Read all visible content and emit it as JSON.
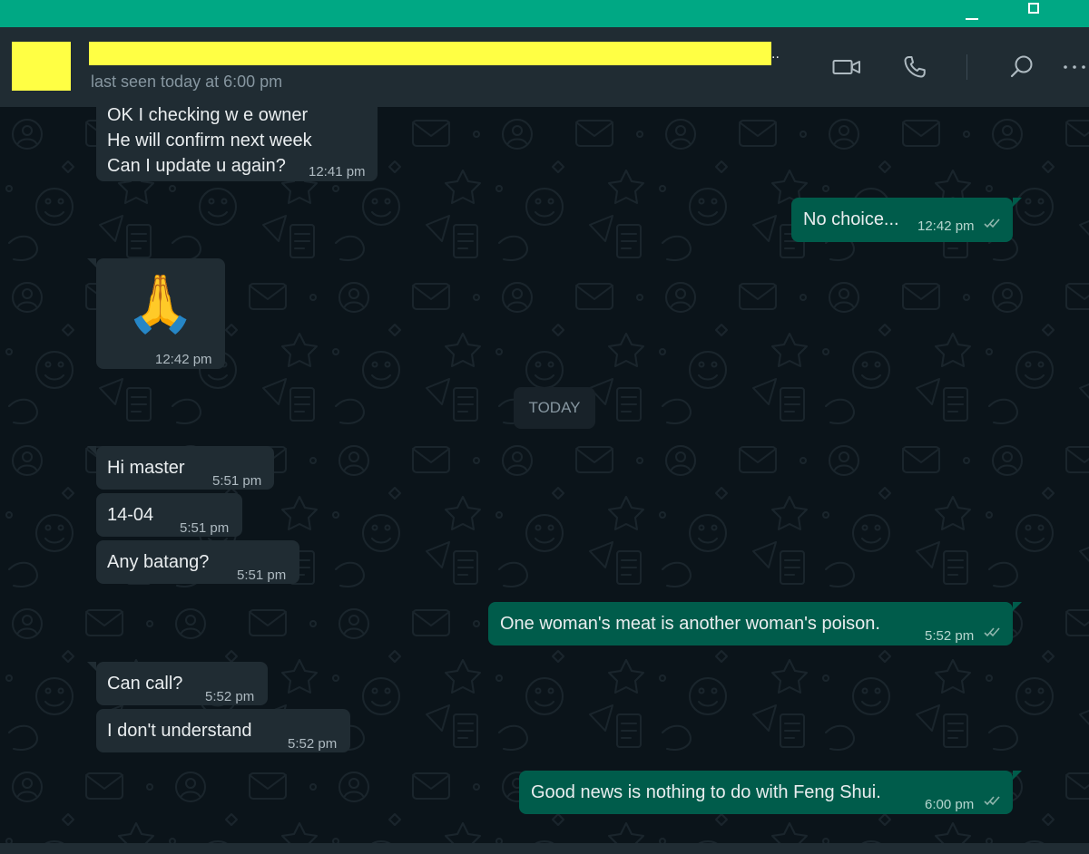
{
  "header": {
    "name_suffix": "..",
    "last_seen": "last seen today at 6:00 pm"
  },
  "icons": {
    "video": "video-call-icon",
    "call": "voice-call-icon",
    "search": "search-icon",
    "more": "more-options-icon"
  },
  "day_divider": "TODAY",
  "messages": [
    {
      "dir": "in",
      "lines": [
        "OK I checking w e owner",
        "He will confirm next week",
        "Can I update u again?"
      ],
      "time": "12:41 pm"
    },
    {
      "dir": "out",
      "text": "No choice...",
      "time": "12:42 pm"
    },
    {
      "dir": "in",
      "emoji": "🙏",
      "time": "12:42 pm"
    },
    {
      "dir": "in",
      "text": "Hi master",
      "time": "5:51 pm"
    },
    {
      "dir": "in",
      "text": "14-04",
      "time": "5:51 pm"
    },
    {
      "dir": "in",
      "text": "Any batang?",
      "time": "5:51 pm"
    },
    {
      "dir": "out",
      "text": "One woman's meat is another woman's poison.",
      "time": "5:52 pm"
    },
    {
      "dir": "in",
      "text": "Can call?",
      "time": "5:52 pm"
    },
    {
      "dir": "in",
      "text": "I don't understand",
      "time": "5:52 pm"
    },
    {
      "dir": "out",
      "text": "Good news is nothing to do with Feng Shui.",
      "time": "6:00 pm"
    }
  ],
  "colors": {
    "accent": "#00a884",
    "header_bg": "#202c33",
    "chat_bg": "#0b141a",
    "incoming_bubble": "#202c33",
    "outgoing_bubble": "#005c4b",
    "redaction": "#ffff44"
  }
}
